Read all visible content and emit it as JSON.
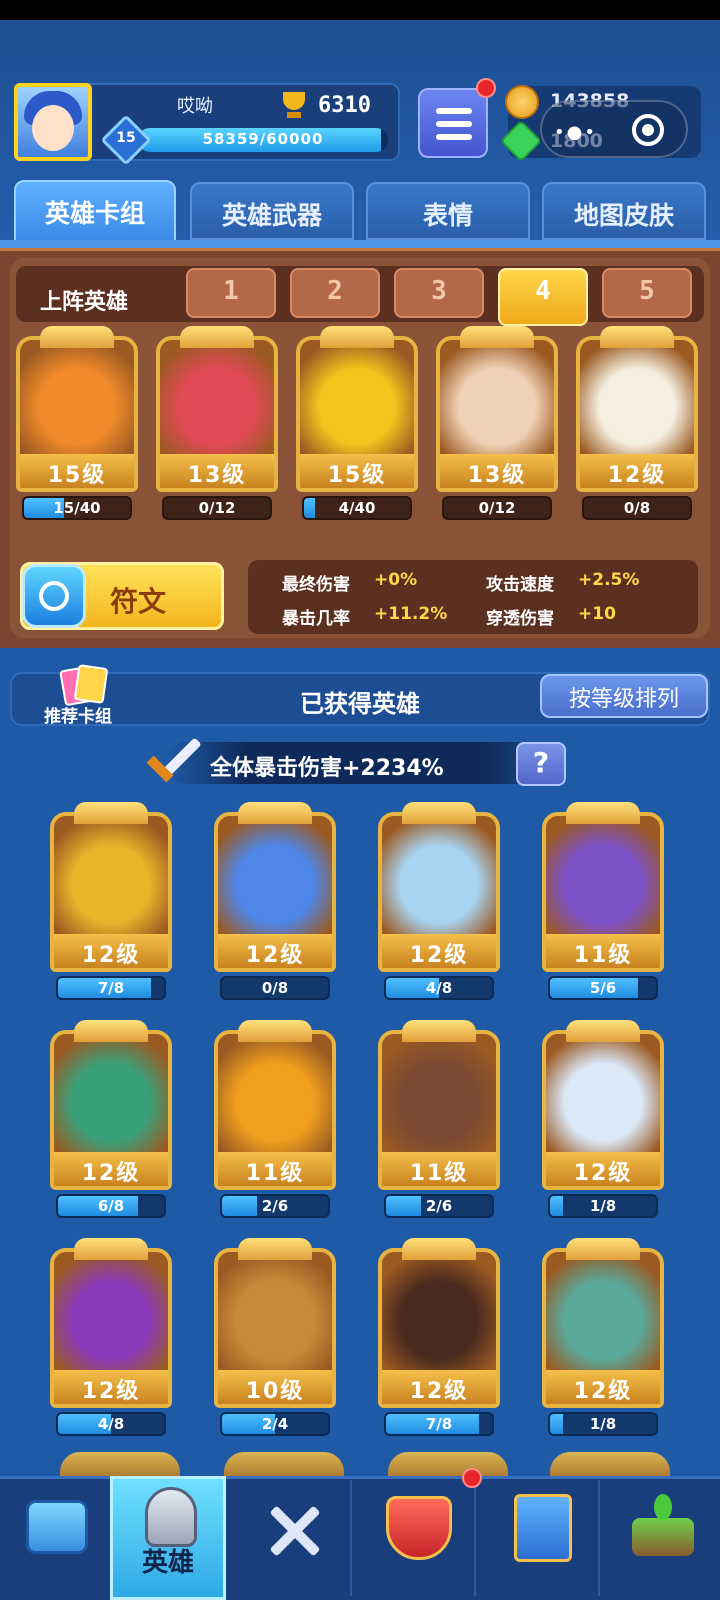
{
  "player": {
    "name": "哎呦",
    "trophies": "6310",
    "level": "15",
    "xp": "58359/60000",
    "xp_fraction": 0.97
  },
  "currency": {
    "coins": "143858",
    "gems": "1800"
  },
  "tabs": [
    "英雄卡组",
    "英雄武器",
    "表情",
    "地图皮肤"
  ],
  "lineup": {
    "title": "上阵英雄",
    "slots": [
      "1",
      "2",
      "3",
      "4",
      "5"
    ],
    "active_slot": 4
  },
  "lineup_heroes": [
    {
      "level": "15级",
      "progress": "15/40",
      "fraction": 0.375,
      "theme": "#f08a2a"
    },
    {
      "level": "13级",
      "progress": "0/12",
      "fraction": 0.0,
      "theme": "#e04a55"
    },
    {
      "level": "15级",
      "progress": "4/40",
      "fraction": 0.1,
      "theme": "#f5c21e"
    },
    {
      "level": "13级",
      "progress": "0/12",
      "fraction": 0.0,
      "theme": "#f2d2b6"
    },
    {
      "level": "12级",
      "progress": "0/8",
      "fraction": 0.0,
      "theme": "#f5efe0"
    }
  ],
  "rune": {
    "label": "符文"
  },
  "stats": [
    {
      "label": "最终伤害",
      "value": "+0%"
    },
    {
      "label": "攻击速度",
      "value": "+2.5%"
    },
    {
      "label": "暴击几率",
      "value": "+11.2%"
    },
    {
      "label": "穿透伤害",
      "value": "+10"
    }
  ],
  "owned": {
    "deck_label": "推荐卡组",
    "title": "已获得英雄",
    "sort_label": "按等级排列"
  },
  "crit": {
    "text": "全体暴击伤害+2234%",
    "help": "?"
  },
  "owned_heroes": [
    {
      "level": "12级",
      "progress": "7/8",
      "fraction": 0.875,
      "theme": "#e8b52a"
    },
    {
      "level": "12级",
      "progress": "0/8",
      "fraction": 0.0,
      "theme": "#4f86e8"
    },
    {
      "level": "12级",
      "progress": "4/8",
      "fraction": 0.5,
      "theme": "#a8d4f2"
    },
    {
      "level": "11级",
      "progress": "5/6",
      "fraction": 0.833,
      "theme": "#7c52c8"
    },
    {
      "level": "12级",
      "progress": "6/8",
      "fraction": 0.75,
      "theme": "#3aa07a"
    },
    {
      "level": "11级",
      "progress": "2/6",
      "fraction": 0.333,
      "theme": "#f0a01e"
    },
    {
      "level": "11级",
      "progress": "2/6",
      "fraction": 0.333,
      "theme": "#7a4a32"
    },
    {
      "level": "12级",
      "progress": "1/8",
      "fraction": 0.125,
      "theme": "#dbe8f8"
    },
    {
      "level": "12级",
      "progress": "4/8",
      "fraction": 0.5,
      "theme": "#8a3ab8"
    },
    {
      "level": "10级",
      "progress": "2/4",
      "fraction": 0.5,
      "theme": "#c88a3a"
    },
    {
      "level": "12级",
      "progress": "7/8",
      "fraction": 0.875,
      "theme": "#4a2a1e"
    },
    {
      "level": "12级",
      "progress": "1/8",
      "fraction": 0.125,
      "theme": "#5aa89a"
    }
  ],
  "nav": [
    {
      "icon": "treasure-chest-icon",
      "label": ""
    },
    {
      "icon": "knight-helmet-icon",
      "label": "英雄"
    },
    {
      "icon": "crossed-swords-icon",
      "label": ""
    },
    {
      "icon": "crown-shield-icon",
      "label": ""
    },
    {
      "icon": "team-banner-icon",
      "label": ""
    },
    {
      "icon": "sprout-island-icon",
      "label": ""
    }
  ],
  "colors": {
    "accent_gold": "#f4b51d",
    "bg_blue": "#1f5aa6",
    "panel_brown": "#7a4630"
  }
}
